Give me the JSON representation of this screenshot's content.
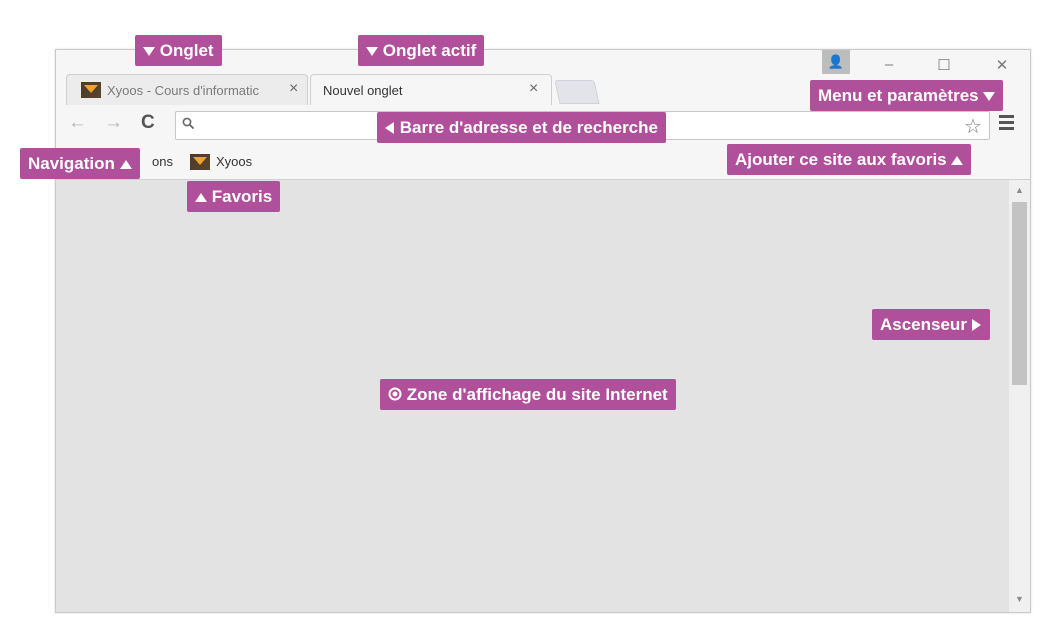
{
  "browser": {
    "tabs": [
      {
        "title": "Xyoos - Cours d'informatic",
        "close": "×",
        "active": false
      },
      {
        "title": "Nouvel onglet",
        "close": "×",
        "active": true
      }
    ],
    "window_controls": {
      "profile": "👤",
      "minimize": "–",
      "maximize": "☐",
      "close": "✕"
    },
    "toolbar": {
      "back": "←",
      "forward": "→",
      "reload": "C",
      "search_icon": "🔍",
      "address_value": "",
      "star": "☆"
    },
    "bookmarks": [
      {
        "label": "ons"
      },
      {
        "label": "Xyoos"
      }
    ],
    "scrollbar": {
      "up": "▲",
      "down": "▼",
      "position": 0.0
    }
  },
  "annotations": {
    "onglet": "Onglet",
    "onglet_actif": "Onglet actif",
    "menu": "Menu et paramètres",
    "adresse": "Barre d'adresse et de recherche",
    "navigation": "Navigation",
    "ajouter_favoris": "Ajouter ce site aux favoris",
    "favoris": "Favoris",
    "ascenseur": "Ascenseur",
    "zone": "Zone d'affichage du site Internet"
  },
  "colors": {
    "annotation_bg": "#b04f9a",
    "window_chrome": "#f6f6f6",
    "content_bg": "#e3e3e3"
  }
}
